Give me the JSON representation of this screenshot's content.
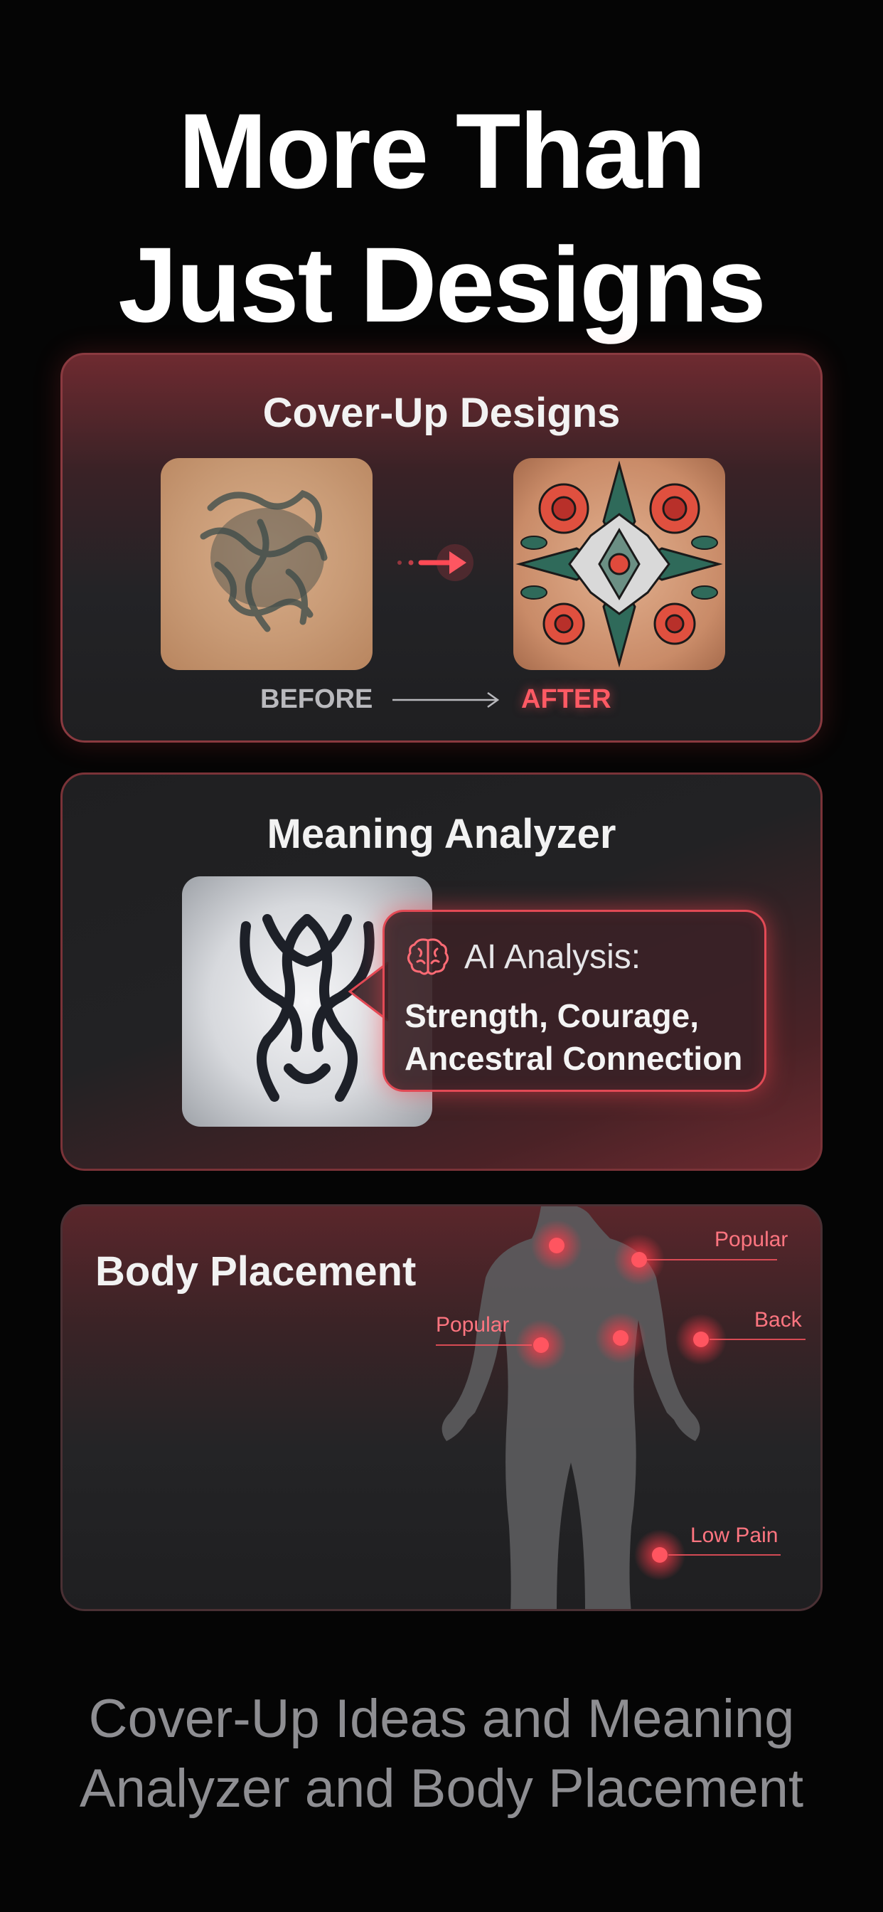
{
  "headline": {
    "line1": "More Than",
    "line2": "Just Designs"
  },
  "cards": {
    "cover_up": {
      "title": "Cover-Up Designs",
      "before_label": "BEFORE",
      "after_label": "AFTER"
    },
    "meaning": {
      "title": "Meaning Analyzer",
      "analysis_heading": "AI Analysis:",
      "analysis_line1": "Strength, Courage,",
      "analysis_line2": "Ancestral Connection",
      "icon": "brain-icon"
    },
    "placement": {
      "title": "Body Placement",
      "tags": {
        "shoulder_right": "Popular",
        "arm_left": "Popular",
        "back": "Back",
        "leg": "Low Pain"
      }
    }
  },
  "footer": {
    "line1": "Cover-Up Ideas and Meaning",
    "line2": "Analyzer and Body Placement"
  },
  "colors": {
    "accent": "#ff4a55",
    "background": "#050505",
    "card": "#232326",
    "muted_text": "#8e8e92"
  }
}
